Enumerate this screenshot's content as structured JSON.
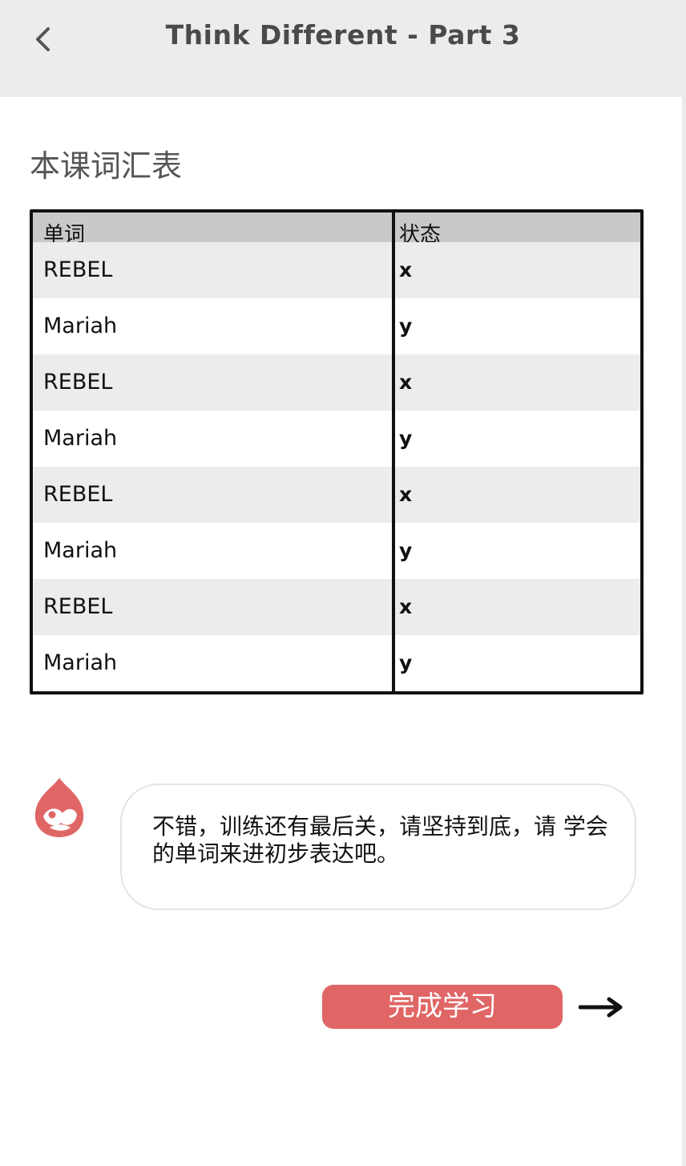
{
  "header": {
    "title": "Think Different - Part 3",
    "back_icon": "chevron-left-icon"
  },
  "section": {
    "title": "本课词汇表"
  },
  "table": {
    "columns": [
      "单词",
      "状态"
    ],
    "rows": [
      {
        "word": "REBEL",
        "status": "x"
      },
      {
        "word": "Mariah",
        "status": "y"
      },
      {
        "word": "REBEL",
        "status": "x"
      },
      {
        "word": "Mariah",
        "status": "y"
      },
      {
        "word": "REBEL",
        "status": "x"
      },
      {
        "word": "Mariah",
        "status": "y"
      },
      {
        "word": "REBEL",
        "status": "x"
      },
      {
        "word": "Mariah",
        "status": "y"
      }
    ]
  },
  "assistant": {
    "avatar_icon": "drupal-drop-icon",
    "message": "不错，训练还有最后关，请坚持到底，请 学会的单词来进初步表达吧。"
  },
  "actions": {
    "complete_label": "完成学习",
    "next_icon": "arrow-right-icon"
  },
  "colors": {
    "accent": "#e06666",
    "header_bg": "#ececec",
    "table_head_bg": "#c9c9c9",
    "table_stripe_bg": "#ececec"
  }
}
